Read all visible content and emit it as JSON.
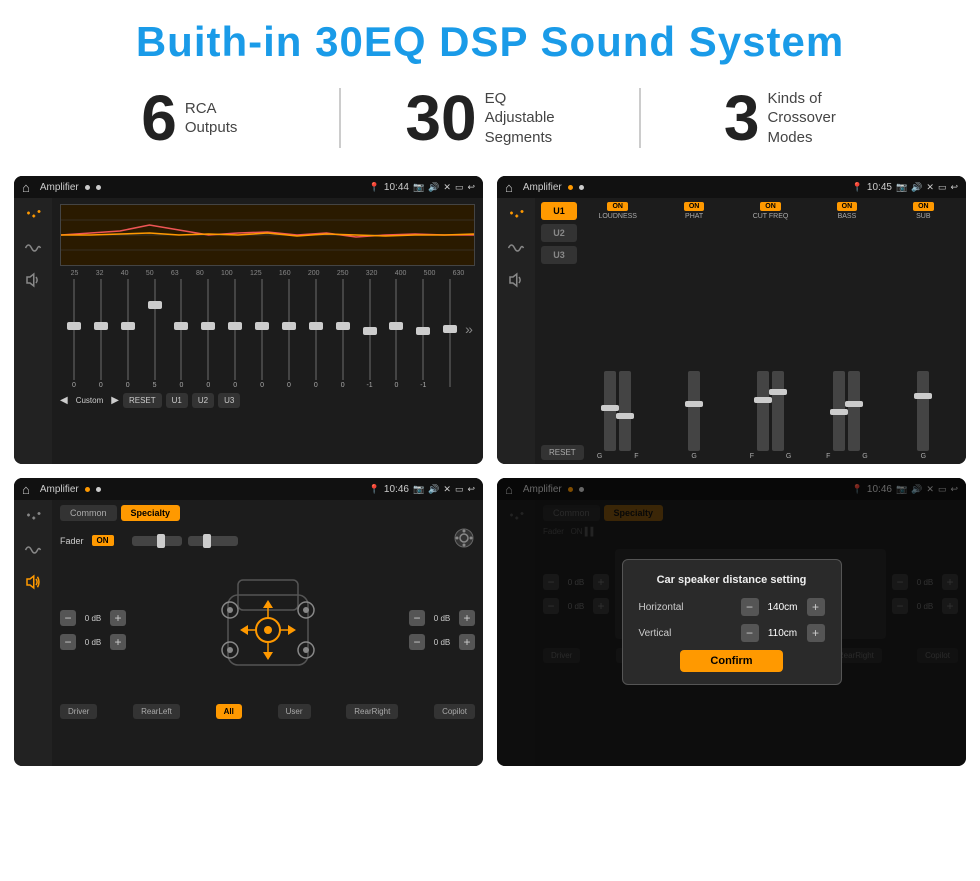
{
  "header": {
    "title": "Buith-in 30EQ DSP Sound System"
  },
  "stats": [
    {
      "number": "6",
      "desc_line1": "RCA",
      "desc_line2": "Outputs"
    },
    {
      "number": "30",
      "desc_line1": "EQ Adjustable",
      "desc_line2": "Segments"
    },
    {
      "number": "3",
      "desc_line1": "Kinds of",
      "desc_line2": "Crossover Modes"
    }
  ],
  "screens": [
    {
      "id": "eq-screen",
      "title": "Amplifier",
      "time": "10:44",
      "type": "eq"
    },
    {
      "id": "xover-screen",
      "title": "Amplifier",
      "time": "10:45",
      "type": "crossover"
    },
    {
      "id": "fader-screen",
      "title": "Amplifier",
      "time": "10:46",
      "type": "fader"
    },
    {
      "id": "dialog-screen",
      "title": "Amplifier",
      "time": "10:46",
      "type": "dialog"
    }
  ],
  "eq": {
    "frequencies": [
      "25",
      "32",
      "40",
      "50",
      "63",
      "80",
      "100",
      "125",
      "160",
      "200",
      "250",
      "320",
      "400",
      "500",
      "630"
    ],
    "values": [
      "0",
      "0",
      "0",
      "5",
      "0",
      "0",
      "0",
      "0",
      "0",
      "0",
      "0",
      "-1",
      "0",
      "-1",
      ""
    ],
    "presets": [
      "Custom",
      "RESET",
      "U1",
      "U2",
      "U3"
    ],
    "thumb_positions": [
      50,
      50,
      50,
      30,
      50,
      50,
      50,
      50,
      50,
      50,
      50,
      55,
      50,
      55,
      50
    ]
  },
  "crossover": {
    "presets": [
      "U1",
      "U2",
      "U3"
    ],
    "controls": [
      {
        "label": "LOUDNESS",
        "on": true
      },
      {
        "label": "PHAT",
        "on": true
      },
      {
        "label": "CUT FREQ",
        "on": true
      },
      {
        "label": "BASS",
        "on": true
      },
      {
        "label": "SUB",
        "on": true
      }
    ]
  },
  "fader": {
    "tabs": [
      "Common",
      "Specialty"
    ],
    "active_tab": "Specialty",
    "fader_label": "Fader",
    "fader_on": "ON",
    "db_values": [
      "0 dB",
      "0 dB",
      "0 dB",
      "0 dB"
    ],
    "buttons": [
      "Driver",
      "RearLeft",
      "All",
      "User",
      "RearRight",
      "Copilot"
    ]
  },
  "dialog": {
    "title": "Car speaker distance setting",
    "horizontal_label": "Horizontal",
    "horizontal_value": "140cm",
    "vertical_label": "Vertical",
    "vertical_value": "110cm",
    "confirm_label": "Confirm",
    "db_values": [
      "0 dB",
      "0 dB"
    ]
  }
}
